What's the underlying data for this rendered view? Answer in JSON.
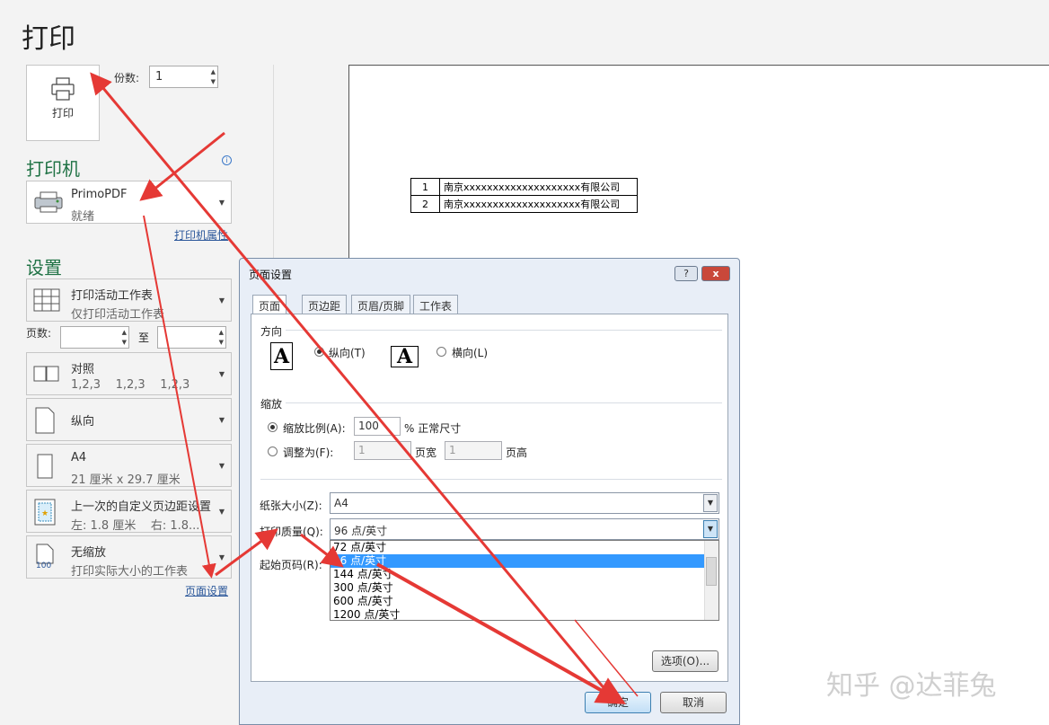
{
  "window": {
    "title_strip": ""
  },
  "page": {
    "title": "打印"
  },
  "print_panel": {
    "print_button_label": "打印",
    "copies_label": "份数:",
    "copies_value": "1"
  },
  "printer": {
    "section_title": "打印机",
    "name": "PrimoPDF",
    "status": "就绪",
    "properties_link": "打印机属性"
  },
  "settings": {
    "section_title": "设置",
    "scope_title": "打印活动工作表",
    "scope_sub": "仅打印活动工作表",
    "pages_label": "页数:",
    "pages_to": "至",
    "collate_title": "对照",
    "collate_sub": "1,2,3    1,2,3    1,2,3",
    "orientation": "纵向",
    "paper_title": "A4",
    "paper_sub": "21 厘米 x 29.7 厘米",
    "margins_title": "上一次的自定义页边距设置",
    "margins_sub": "左: 1.8 厘米    右: 1.8...",
    "scaling_title": "无缩放",
    "scaling_sub": "打印实际大小的工作表",
    "scaling_icon_text": "100",
    "page_setup_link": "页面设置"
  },
  "preview": {
    "rows": [
      {
        "num": "1",
        "name": "南京xxxxxxxxxxxxxxxxxxxx有限公司"
      },
      {
        "num": "2",
        "name": "南京xxxxxxxxxxxxxxxxxxxx有限公司"
      }
    ]
  },
  "dialog": {
    "title": "页面设置",
    "help": "?",
    "close": "x",
    "tabs": [
      "页面",
      "页边距",
      "页眉/页脚",
      "工作表"
    ],
    "orientation_group": "方向",
    "portrait_label": "纵向(T)",
    "landscape_label": "横向(L)",
    "glyph": "A",
    "scaling_group": "缩放",
    "scale_label": "缩放比例(A):",
    "scale_value": "100",
    "scale_suffix": "% 正常尺寸",
    "fit_label": "调整为(F):",
    "fit_wide_value": "1",
    "fit_wide_suffix": "页宽",
    "fit_tall_value": "1",
    "fit_tall_suffix": "页高",
    "paper_size_label": "纸张大小(Z):",
    "paper_size_value": "A4",
    "print_quality_label": "打印质量(Q):",
    "print_quality_value": "96 点/英寸",
    "first_page_label": "起始页码(R):",
    "quality_options": [
      "72 点/英寸",
      "96 点/英寸",
      "144 点/英寸",
      "300 点/英寸",
      "600 点/英寸",
      "1200 点/英寸"
    ],
    "quality_selected_index": 1,
    "options_button": "选项(O)...",
    "ok_button": "确定",
    "cancel_button": "取消"
  },
  "watermark": "知乎 @达菲兔",
  "colors": {
    "accent_green": "#217346",
    "annotation_red": "#e53935",
    "selection_blue": "#3399ff"
  }
}
